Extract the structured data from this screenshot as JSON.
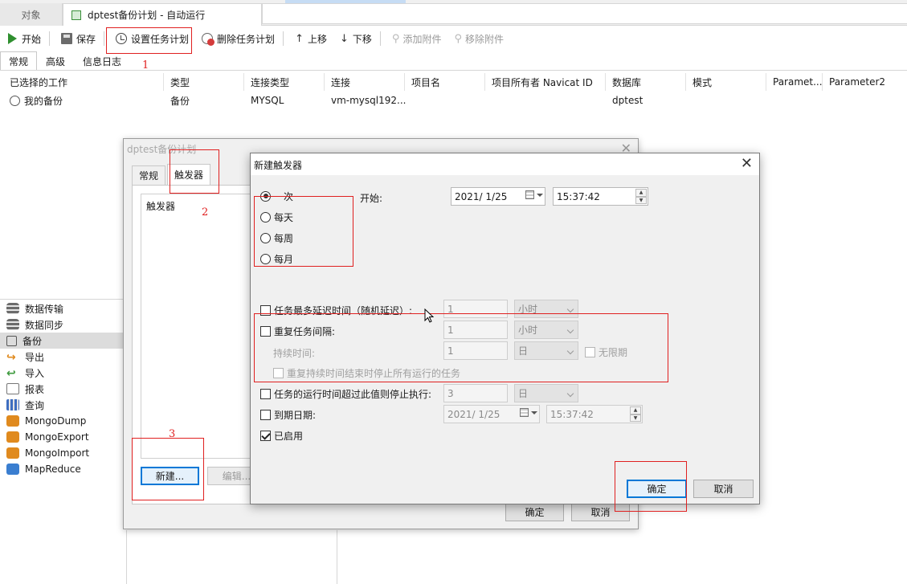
{
  "tabs": {
    "objects": "对象",
    "plan": "dptest备份计划 - 自动运行"
  },
  "toolbar": {
    "start": "开始",
    "save": "保存",
    "set_schedule": "设置任务计划",
    "delete_schedule": "删除任务计划",
    "move_up": "上移",
    "move_down": "下移",
    "add_attachment": "添加附件",
    "remove_attachment": "移除附件"
  },
  "subtabs": [
    "常规",
    "高级",
    "信息日志"
  ],
  "grid": {
    "headers": [
      "已选择的工作",
      "类型",
      "连接类型",
      "连接",
      "项目名",
      "项目所有者 Navicat ID",
      "数据库",
      "模式",
      "Paramet...",
      "Parameter2"
    ],
    "row": [
      "我的备份",
      "备份",
      "MYSQL",
      "vm-mysql192...",
      "",
      "",
      "dptest",
      "",
      "",
      ""
    ]
  },
  "left_list": [
    "数据传输",
    "数据同步",
    "备份",
    "导出",
    "导入",
    "报表",
    "查询",
    "MongoDump",
    "MongoExport",
    "MongoImport",
    "MapReduce"
  ],
  "plan_dialog": {
    "title": "dptest备份计划",
    "tabs": [
      "常规",
      "触发器"
    ],
    "trigger_list_label": "触发器",
    "new_button": "新建...",
    "edit_button": "编辑...",
    "ok": "确定",
    "cancel": "取消"
  },
  "trigger_dialog": {
    "title": "新建触发器",
    "radios": [
      "一次",
      "每天",
      "每周",
      "每月"
    ],
    "start_label": "开始:",
    "start_date": "2021/  1/25",
    "start_time": "15:37:42",
    "max_delay_label": "任务最多延迟时间（随机延迟）:",
    "max_delay_value": "1",
    "max_delay_unit": "小时",
    "repeat_label": "重复任务间隔:",
    "repeat_value": "1",
    "repeat_unit": "小时",
    "duration_label": "持续时间:",
    "duration_value": "1",
    "duration_unit": "日",
    "unlimited_label": "无限期",
    "stop_at_end_label": "重复持续时间结束时停止所有运行的任务",
    "stop_if_longer_label": "任务的运行时间超过此值则停止执行:",
    "stop_if_longer_value": "3",
    "stop_if_longer_unit": "日",
    "expire_label": "到期日期:",
    "expire_date": "2021/  1/25",
    "expire_time": "15:37:42",
    "enabled_label": "已启用",
    "ok": "确定",
    "cancel": "取消"
  },
  "annotations": [
    "1",
    "2",
    "3"
  ],
  "colors": {
    "annotation": "#e02020",
    "default_button_border": "#0078d7"
  }
}
